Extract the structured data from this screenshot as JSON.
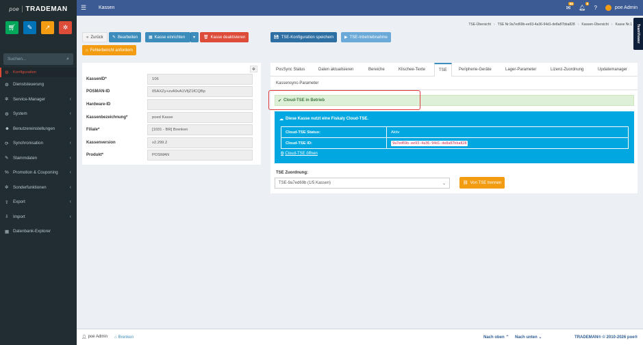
{
  "app": {
    "logo_prefix": "poe",
    "logo_sep": "|",
    "logo_name": "TRADEMAN"
  },
  "sidebar": {
    "search_placeholder": "Suchen...",
    "items": [
      {
        "label": "Konfiguration",
        "icon": "gear-icon",
        "glyph": "⚙",
        "active": true
      },
      {
        "label": "Dienststeuerung",
        "icon": "gear-icon",
        "glyph": "⚙"
      },
      {
        "label": "Service-Manager",
        "icon": "cogs-icon",
        "glyph": "✲"
      },
      {
        "label": "System",
        "icon": "gear-icon",
        "glyph": "⚙"
      },
      {
        "label": "Benutzereinstellungen",
        "icon": "users-icon",
        "glyph": "☻"
      },
      {
        "label": "Synchronisation",
        "icon": "refresh-icon",
        "glyph": "⟳"
      },
      {
        "label": "Stammdaten",
        "icon": "wrench-icon",
        "glyph": "✎"
      },
      {
        "label": "Promotion & Couponing",
        "icon": "percent-icon",
        "glyph": "%"
      },
      {
        "label": "Sonderfunktionen",
        "icon": "cogs-icon",
        "glyph": "✲"
      },
      {
        "label": "Export",
        "icon": "export-icon",
        "glyph": "⇪"
      },
      {
        "label": "Import",
        "icon": "import-icon",
        "glyph": "⇩"
      },
      {
        "label": "Datenbank-Explorer",
        "icon": "table-icon",
        "glyph": "▦"
      }
    ]
  },
  "topbar": {
    "title": "Kassen",
    "mail_badge": "55",
    "bell_badge": "6",
    "user": "poe Admin"
  },
  "teamviewer": "TeamViewer",
  "breadcrumb": [
    "TSE-Übersicht",
    "TSE Nr.9a7ed69b-ee93-4a36-94d1-de8a87bba828",
    "Kassen-Übersicht",
    "Kasse Nr.1"
  ],
  "toolbar": {
    "back": "Zurück",
    "edit": "Bearbeiten",
    "setup": "Kasse einrichten",
    "deactivate": "Kasse deaktivieren",
    "save_tse": "TSE-Konfiguration speichern",
    "tse_start": "TSE-Inbetriebnahme",
    "error_report": "Fehlerbericht anfordern"
  },
  "details": [
    {
      "key": "KassenID*",
      "value": "106"
    },
    {
      "key": "POSMAN-ID",
      "value": "05AXZy+zvA9vA1VfjZ1fCQBp"
    },
    {
      "key": "Hardware-ID",
      "value": ""
    },
    {
      "key": "Kassenbezeichnung*",
      "value": "poed Kasse"
    },
    {
      "key": "Filiale*",
      "value": "[1031 - BR] Brenken"
    },
    {
      "key": "Kassenversion",
      "value": "v2.299.2"
    },
    {
      "key": "Produkt*",
      "value": "POSMAN"
    }
  ],
  "tabs": [
    {
      "label": "PosSync Status"
    },
    {
      "label": "Daten aktualisieren"
    },
    {
      "label": "Bereiche"
    },
    {
      "label": "Klischee-Texte"
    },
    {
      "label": "TSE",
      "active": true
    },
    {
      "label": "Peripherie-Geräte"
    },
    {
      "label": "Lager-Parameter"
    },
    {
      "label": "Lizenz-Zuordnung"
    },
    {
      "label": "Updatemanager"
    },
    {
      "label": "Kassensync-Parameter"
    }
  ],
  "tse": {
    "status_msg": "Cloud-TSE in Betrieb",
    "cloud_title": "Diese Kasse nutzt eine Fiskaly Cloud-TSE.",
    "status_label": "Cloud-TSE Status:",
    "status_value": "Aktiv",
    "id_label": "Cloud-TSE ID:",
    "id_value": "9a7ed69b-ee93-4a36-94d1-de8a87bba828",
    "open_link": "Cloud-TSE öffnen",
    "assign_label": "TSE Zuordnung:",
    "assign_value": "TSE-9a7ed69b (1/5 Kassen)",
    "disconnect": "Von TSE trennen"
  },
  "footer": {
    "user": "poe Admin",
    "branch": "Brenken",
    "up": "Nach oben",
    "down": "Nach unten",
    "copyright": "TRADEMAN® © 2010-2026 poe®"
  },
  "colors": {
    "sidebar": "#222d32",
    "topbar": "#3c5a93",
    "primary": "#3c8dbc",
    "danger": "#dd4b39",
    "warning": "#f39c12",
    "info": "#00a7e1",
    "success_bg": "#dff0d8"
  }
}
